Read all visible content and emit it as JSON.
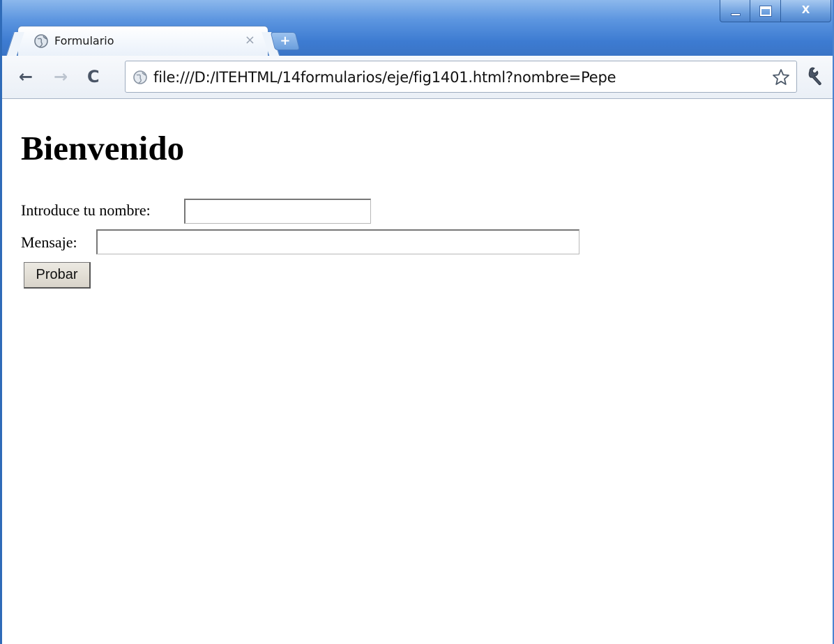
{
  "browser": {
    "tab": {
      "title": "Formulario",
      "close_glyph": "×",
      "favicon": "globe-icon"
    },
    "new_tab_glyph": "+",
    "window_controls": {
      "minimize": "minimize-icon",
      "maximize": "maximize-icon",
      "close_glyph": "X"
    },
    "toolbar": {
      "back_glyph": "←",
      "forward_glyph": "→",
      "reload_glyph": "C",
      "url": "file:///D:/ITEHTML/14formularios/eje/fig1401.html?nombre=Pepe",
      "bookmark": "star-icon",
      "menu": "wrench-icon"
    },
    "colors": {
      "frame_blue": "#3d7bd1",
      "toolbar": "#eaeff6"
    }
  },
  "page": {
    "heading": "Bienvenido",
    "nombre_label": "Introduce tu nombre:",
    "nombre_value": "",
    "mensaje_label": "Mensaje:",
    "mensaje_value": "",
    "submit_label": "Probar"
  }
}
